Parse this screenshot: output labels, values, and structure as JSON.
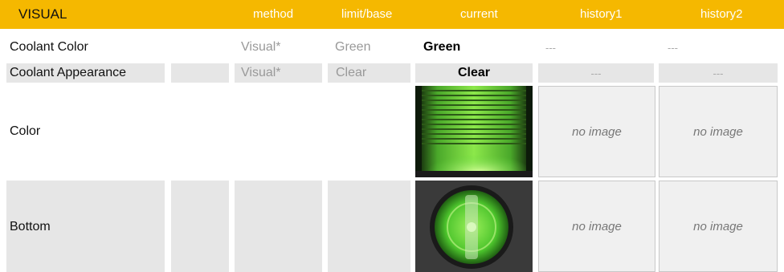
{
  "header": {
    "title": "VISUAL",
    "method": "method",
    "limit": "limit/base",
    "current": "current",
    "history1": "history1",
    "history2": "history2"
  },
  "rows": [
    {
      "label": "Coolant Color",
      "method": "Visual*",
      "limit": "Green",
      "current": "Green",
      "history1": "---",
      "history2": "---"
    },
    {
      "label": "Coolant Appearance",
      "method": "Visual*",
      "limit": "Clear",
      "current": "Clear",
      "history1": "---",
      "history2": "---"
    }
  ],
  "image_rows": [
    {
      "label": "Color",
      "history1": "no image",
      "history2": "no image"
    },
    {
      "label": "Bottom",
      "history1": "no image",
      "history2": "no image"
    }
  ],
  "colors": {
    "accent": "#f5b800",
    "row_gray": "#e6e6e6",
    "coolant_green": "#5fd23a"
  }
}
